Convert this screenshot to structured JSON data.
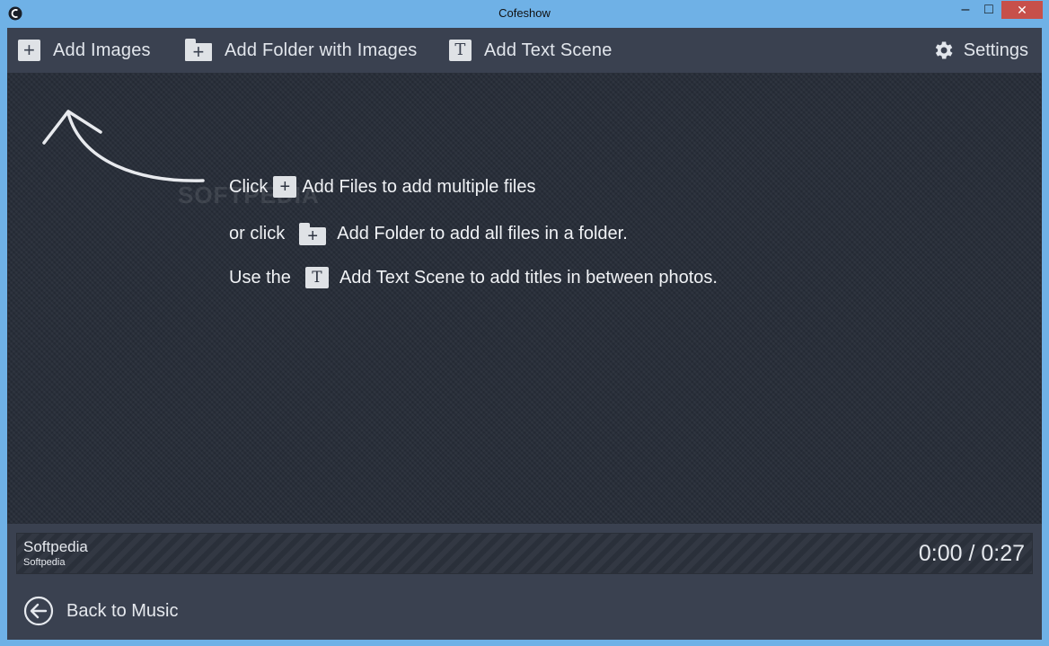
{
  "window": {
    "title": "Cofeshow",
    "min_label": "‒",
    "max_label": "□",
    "close_label": "✕"
  },
  "toolbar": {
    "add_images": "Add Images",
    "add_folder": "Add Folder with Images",
    "add_text_scene": "Add Text Scene",
    "settings": "Settings"
  },
  "hints": {
    "line1_prefix": "Click",
    "line1_suffix": "Add Files to add multiple files",
    "line2_prefix": "or click",
    "line2_suffix": "Add Folder to add all files in a folder.",
    "line3_prefix": "Use the",
    "line3_suffix": "Add Text Scene to add titles in between photos."
  },
  "watermark": "SOFTPEDIA",
  "music": {
    "title": "Softpedia",
    "artist": "Softpedia",
    "time": "0:00 / 0:27"
  },
  "footer": {
    "back_label": "Back to Music"
  },
  "colors": {
    "titlebar": "#6fb1e6",
    "toolbar": "#3a4150",
    "stage": "#262c37",
    "close": "#c7504a"
  }
}
